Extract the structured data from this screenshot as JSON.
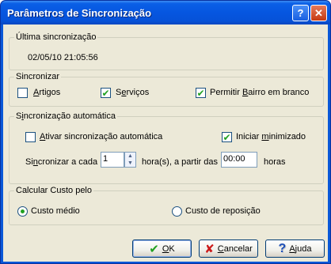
{
  "window": {
    "title": "Parâmetros de Sincronização",
    "help_label": "?",
    "close_label": "✕"
  },
  "last_sync": {
    "legend": "Última sincronização",
    "value": "02/05/10 21:05:56"
  },
  "sync": {
    "legend": "Sincronizar",
    "artigos": {
      "pre": "",
      "hot": "A",
      "post": "rtigos",
      "checked": false
    },
    "servicos": {
      "pre": "S",
      "hot": "e",
      "post": "rviços",
      "checked": true
    },
    "bairro": {
      "pre": "Permitir ",
      "hot": "B",
      "post": "airro em branco",
      "checked": true
    }
  },
  "auto": {
    "legend_pre": "S",
    "legend_hot": "i",
    "legend_post": "ncronização automática",
    "ativar": {
      "pre": "",
      "hot": "A",
      "post": "tivar sincronização automática",
      "checked": false
    },
    "iniciar": {
      "pre": "Iniciar ",
      "hot": "m",
      "post": "inimizado",
      "checked": true
    },
    "interval_label_pre": "Si",
    "interval_label_hot": "n",
    "interval_label_post": "cronizar a cada",
    "interval_value": "1",
    "hours_text": "hora(s), a partir das",
    "start_time": "00:00",
    "horas": "horas"
  },
  "cost": {
    "legend": "Calcular Custo pelo",
    "medio": {
      "label": "Custo médio",
      "selected": true
    },
    "reposicao": {
      "label": "Custo de reposição",
      "selected": false
    }
  },
  "buttons": {
    "ok": {
      "hot": "O",
      "post": "K"
    },
    "cancel": {
      "hot": "C",
      "post": "ancelar"
    },
    "help": {
      "hot": "A",
      "post": "juda"
    }
  },
  "colors": {
    "title_bar": "#0656e0",
    "dialog_bg": "#ece9d8",
    "check_mark": "#21a121",
    "cancel_x": "#cc1a1a"
  },
  "icons": {
    "ok": "checkmark-icon",
    "cancel": "x-icon",
    "help": "question-icon"
  }
}
